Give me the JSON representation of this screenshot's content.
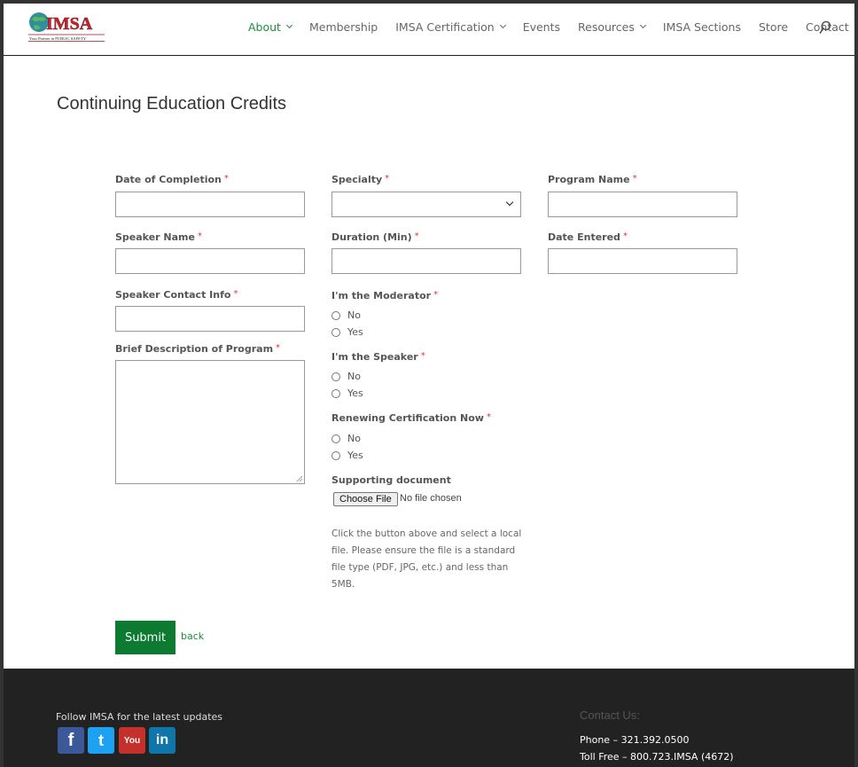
{
  "header": {
    "logo_text": "IMSA",
    "logo_tagline": "Your Partner in PUBLIC SAFETY",
    "nav": [
      {
        "label": "About",
        "active": true,
        "dropdown": true
      },
      {
        "label": "Membership",
        "active": false,
        "dropdown": false
      },
      {
        "label": "IMSA Certification",
        "active": false,
        "dropdown": true
      },
      {
        "label": "Events",
        "active": false,
        "dropdown": false
      },
      {
        "label": "Resources",
        "active": false,
        "dropdown": true
      },
      {
        "label": "IMSA Sections",
        "active": false,
        "dropdown": false
      },
      {
        "label": "Store",
        "active": false,
        "dropdown": false
      },
      {
        "label": "Contact",
        "active": false,
        "dropdown": false
      }
    ]
  },
  "page": {
    "title": "Continuing Education Credits"
  },
  "form": {
    "required_mark": "*",
    "date_of_completion": {
      "label": "Date of Completion",
      "value": ""
    },
    "specialty": {
      "label": "Specialty",
      "value": ""
    },
    "program_name": {
      "label": "Program Name",
      "value": ""
    },
    "speaker_name": {
      "label": "Speaker Name",
      "value": ""
    },
    "duration": {
      "label": "Duration (Min)",
      "value": ""
    },
    "date_entered": {
      "label": "Date Entered",
      "value": ""
    },
    "speaker_contact": {
      "label": "Speaker Contact Info",
      "value": ""
    },
    "description": {
      "label": "Brief Description of Program",
      "value": ""
    },
    "moderator": {
      "label": "I'm the Moderator",
      "options": [
        "No",
        "Yes"
      ]
    },
    "speaker": {
      "label": "I'm the Speaker",
      "options": [
        "No",
        "Yes"
      ]
    },
    "renewing": {
      "label": "Renewing Certification Now",
      "options": [
        "No",
        "Yes"
      ]
    },
    "supporting_doc": {
      "label": "Supporting document",
      "button": "Choose File",
      "status": "No file chosen",
      "help": "Click the button above and select a local file. Please ensure the file is a standard file type (PDF, JPG, etc.) and less than 5MB."
    },
    "submit_label": "Submit",
    "back_label": "back"
  },
  "footer": {
    "follow_text": "Follow IMSA for the latest updates",
    "social": [
      {
        "name": "facebook",
        "glyph": "f",
        "color": "#3b5998"
      },
      {
        "name": "twitter",
        "glyph": "t",
        "color": "#1da1f2"
      },
      {
        "name": "youtube",
        "glyph": "You",
        "color": "#c4302b"
      },
      {
        "name": "linkedin",
        "glyph": "in",
        "color": "#0e76a8"
      }
    ],
    "contact_title": "Contact Us:",
    "phone": "Phone – 321.392.0500",
    "toll_free": "Toll Free – 800.723.IMSA (4672)"
  },
  "colors": {
    "accent": "#1d8e3c",
    "submit_bg": "#0c7a30",
    "required": "#dd3333",
    "footer_bg": "#222222"
  }
}
